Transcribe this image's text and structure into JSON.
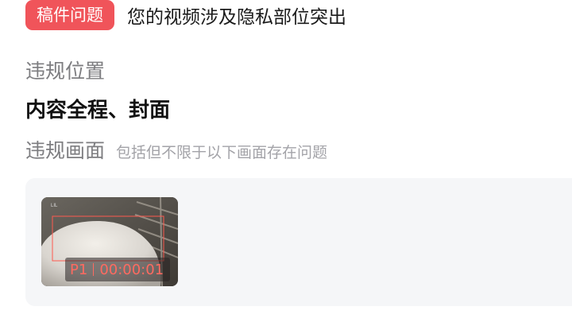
{
  "issue": {
    "tag_label": "稿件问题",
    "title": "您的视频涉及隐私部位突出"
  },
  "violation_location": {
    "label": "违规位置",
    "value": "内容全程、封面"
  },
  "violation_frames": {
    "label": "违规画面",
    "hint": "包括但不限于以下画面存在问题",
    "frames": [
      {
        "page": "P1",
        "timestamp": "00:00:01"
      }
    ]
  },
  "colors": {
    "tag_background": "#f0545a",
    "badge_text": "#ff6a60",
    "panel_background": "#f5f6f8"
  }
}
